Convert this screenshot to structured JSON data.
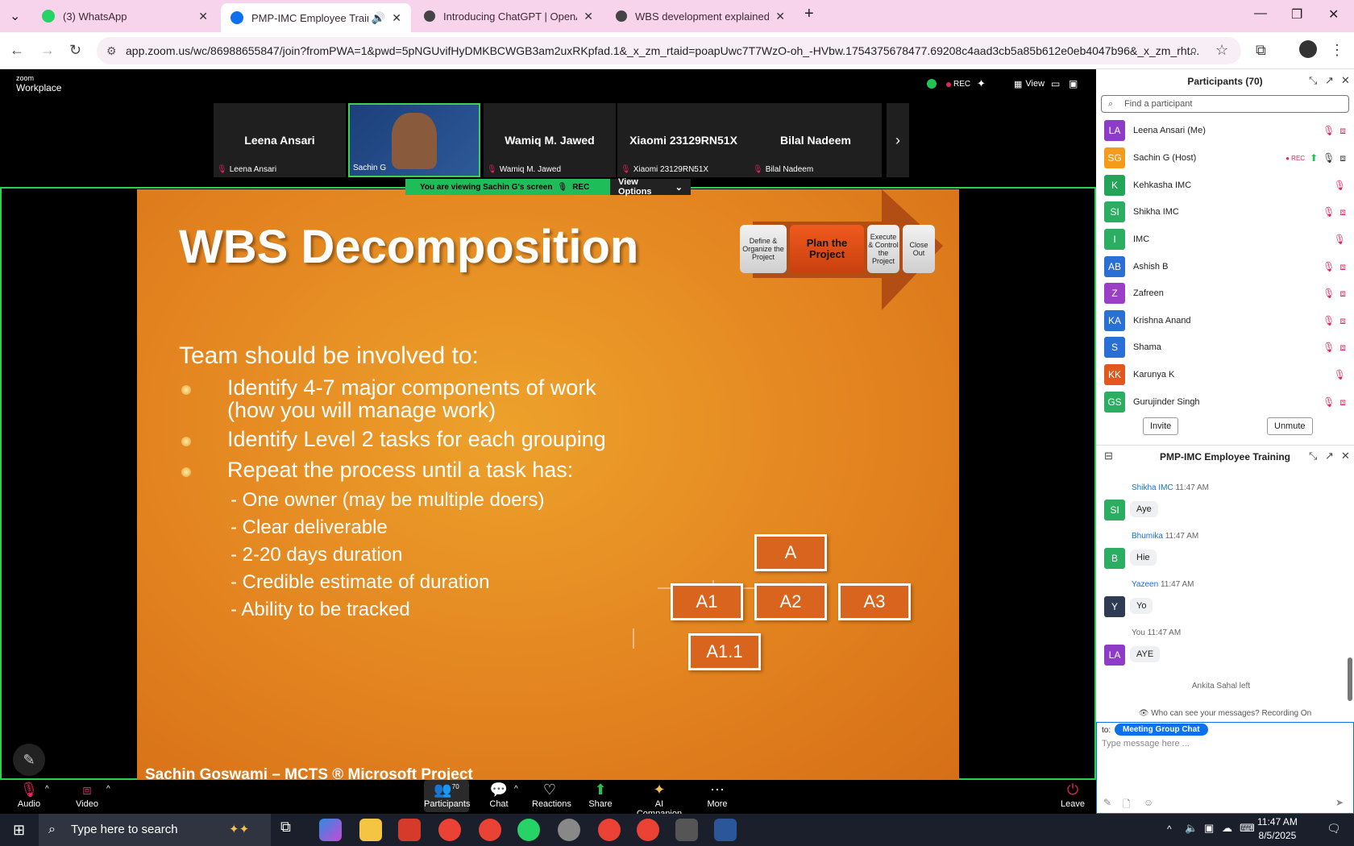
{
  "browser": {
    "tabs": [
      {
        "title": "(3) WhatsApp",
        "color": "#25d366"
      },
      {
        "title": "PMP-IMC Employee Training",
        "color": "#0e71eb"
      },
      {
        "title": "Introducing ChatGPT | OpenAI",
        "color": "#444444"
      },
      {
        "title": "WBS development explained",
        "color": "#444444"
      }
    ],
    "url": "app.zoom.us/wc/86988655847/join?fromPWA=1&pwd=5pNGUvifHyDMKBCWGB3am2uxRKpfad.1&_x_zm_rtaid=poapUwc7T7WzO-oh_-HVbw.1754375678477.69208c4aad3cb5a85b612e0eb4047b96&_x_zm_rht..."
  },
  "zoom": {
    "brand_small": "zoom",
    "brand": "Workplace",
    "rec_label": "REC",
    "view_label": "View",
    "video_tiles": [
      {
        "name": "Leena Ansari",
        "label": "Leena Ansari"
      },
      {
        "name": "",
        "label": "Sachin G"
      },
      {
        "name": "Wamiq M. Jawed",
        "label": "Wamiq M. Jawed"
      },
      {
        "name": "Xiaomi 23129RN51X",
        "label": "Xiaomi 23129RN51X"
      },
      {
        "name": "Bilal Nadeem",
        "label": "Bilal Nadeem"
      }
    ],
    "viewing_banner": "You are viewing  Sachin G's screen",
    "view_options": "View Options",
    "toolbar": {
      "audio": "Audio",
      "video": "Video",
      "participants": "Participants",
      "participants_count": "70",
      "chat": "Chat",
      "reactions": "Reactions",
      "share": "Share",
      "ai": "AI Companion",
      "more": "More",
      "leave": "Leave"
    }
  },
  "slide": {
    "title": "WBS Decomposition",
    "intro": "Team should be involved to:",
    "bullets": [
      "Identify 4-7 major components of work",
      "(how you will manage work)",
      "Identify Level 2 tasks for each grouping",
      "Repeat the process until a task has:"
    ],
    "sub_items": [
      "- One owner (may be multiple doers)",
      "- Clear deliverable",
      "- 2-20 days duration",
      "- Credible estimate of duration",
      "- Ability to be tracked"
    ],
    "process_steps": [
      "Define & Organize the Project",
      "Plan the Project",
      "Execute & Control the Project",
      "Close Out"
    ],
    "tree": [
      "A",
      "A1",
      "A2",
      "A3",
      "A1.1"
    ],
    "footer": "Sachin Goswami – MCTS ® Microsoft Project"
  },
  "participants": {
    "title": "Participants (70)",
    "search_placeholder": "Find a participant",
    "list": [
      {
        "initials": "LA",
        "name": "Leena Ansari (Me)",
        "color": "#8e3bc7"
      },
      {
        "initials": "SG",
        "name": "Sachin G (Host)",
        "color": "#f59b1b"
      },
      {
        "initials": "K",
        "name": "Kehkasha IMC",
        "color": "#23a559"
      },
      {
        "initials": "SI",
        "name": "Shikha IMC",
        "color": "#2bae62"
      },
      {
        "initials": "I",
        "name": "IMC",
        "color": "#2bae62"
      },
      {
        "initials": "AB",
        "name": "Ashish B",
        "color": "#2a6fd6"
      },
      {
        "initials": "Z",
        "name": "Zafreen",
        "color": "#9b3fc6"
      },
      {
        "initials": "KA",
        "name": "Krishna Anand",
        "color": "#2a6fd6"
      },
      {
        "initials": "S",
        "name": "Shama",
        "color": "#2a6fd6"
      },
      {
        "initials": "KK",
        "name": "Karunya K",
        "color": "#e2571e"
      },
      {
        "initials": "GS",
        "name": "Gurujinder Singh",
        "color": "#2bae62"
      }
    ],
    "rec": "REC",
    "invite": "Invite",
    "unmute": "Unmute"
  },
  "chat": {
    "title": "PMP-IMC Employee Training",
    "messages": [
      {
        "sender": "Shikha IMC",
        "time": "11:47 AM",
        "text": "Aye",
        "initials": "SI",
        "color": "#2bae62"
      },
      {
        "sender": "Bhumika",
        "time": "11:47 AM",
        "text": "Hie",
        "initials": "B",
        "color": "#2bae62"
      },
      {
        "sender": "Yazeen",
        "time": "11:47 AM",
        "text": "Yo",
        "initials": "Y",
        "color": "#2f3b52"
      },
      {
        "sender": "You",
        "time": "11:47 AM",
        "text": "AYE",
        "initials": "LA",
        "color": "#8e3bc7"
      }
    ],
    "system": "Ankita Sahal left",
    "visibility": "Who can see your messages? Recording On",
    "to_label": "to:",
    "to_target": "Meeting Group Chat",
    "placeholder": "Type message here ..."
  },
  "taskbar": {
    "search_placeholder": "Type here to search",
    "time": "11:47 AM",
    "date": "8/5/2025"
  }
}
